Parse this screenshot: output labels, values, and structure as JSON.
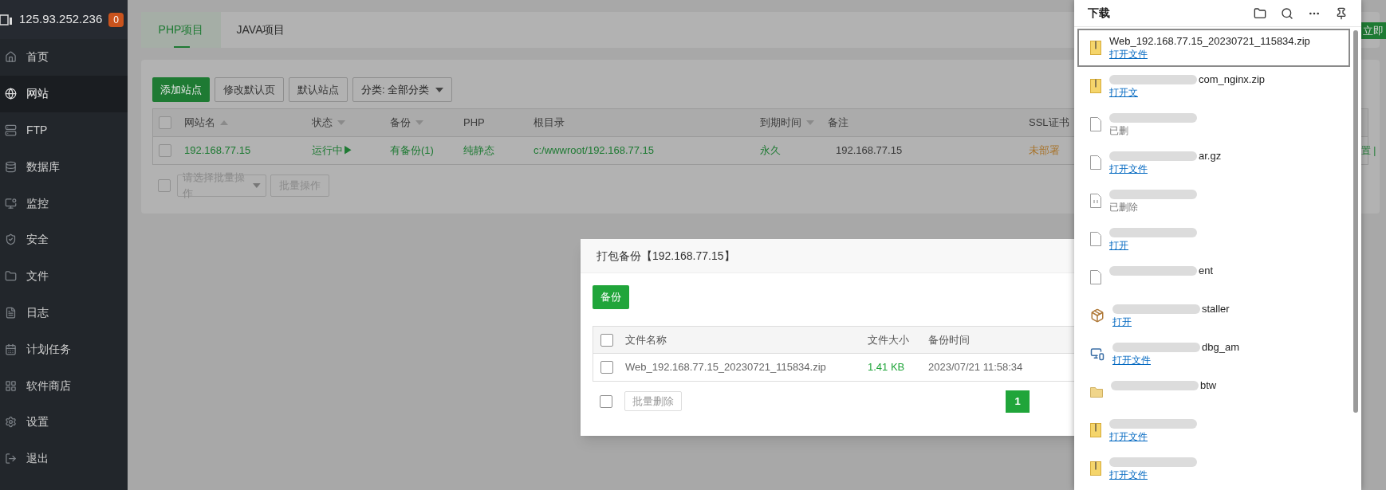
{
  "sidebar": {
    "host": "125.93.252.236",
    "badge": "0",
    "items": [
      {
        "label": "首页",
        "selected": false
      },
      {
        "label": "网站",
        "selected": true
      },
      {
        "label": "FTP",
        "selected": false
      },
      {
        "label": "数据库",
        "selected": false
      },
      {
        "label": "监控",
        "selected": false
      },
      {
        "label": "安全",
        "selected": false
      },
      {
        "label": "文件",
        "selected": false
      },
      {
        "label": "日志",
        "selected": false
      },
      {
        "label": "计划任务",
        "selected": false
      },
      {
        "label": "软件商店",
        "selected": false
      },
      {
        "label": "设置",
        "selected": false
      },
      {
        "label": "退出",
        "selected": false
      }
    ]
  },
  "tabs": [
    {
      "label": "PHP项目",
      "selected": true
    },
    {
      "label": "JAVA项目",
      "selected": false
    }
  ],
  "toolbar": {
    "buttons": [
      {
        "label": "添加站点",
        "kind": "primary"
      },
      {
        "label": "修改默认页",
        "kind": "default"
      },
      {
        "label": "默认站点",
        "kind": "default"
      }
    ],
    "category": "分类: 全部分类"
  },
  "sites_table": {
    "select_all_checked": false,
    "columns": [
      {
        "label": "网站名",
        "kind": "ascending"
      },
      {
        "label": "状态",
        "kind": "descending"
      },
      {
        "label": "备份",
        "kind": "descending"
      },
      {
        "label": "PHP",
        "kind": "plain"
      },
      {
        "label": "根目录",
        "kind": "plain"
      },
      {
        "label": "到期时间",
        "kind": "descending"
      },
      {
        "label": "备注",
        "kind": "plain"
      },
      {
        "label": "SSL证书",
        "kind": "plain"
      }
    ],
    "rows": [
      {
        "checked": false,
        "cells": [
          {
            "text": "192.168.77.15",
            "kind": "link"
          },
          {
            "text": "运行中▶",
            "kind": "link"
          },
          {
            "text": "有备份(1)",
            "kind": "link"
          },
          {
            "text": "纯静态",
            "kind": "link"
          },
          {
            "text": "c:/wwwroot/192.168.77.15",
            "kind": "link"
          },
          {
            "text": "永久",
            "kind": "link"
          },
          {
            "text": "192.168.77.15",
            "kind": "text"
          },
          {
            "text": "未部署",
            "kind": "warning"
          }
        ]
      }
    ]
  },
  "batch": {
    "checked": false,
    "placeholder": "请选择批量操作",
    "button": "批量操作"
  },
  "behind_panel": {
    "button": "立即",
    "row_actions": "置 |"
  },
  "dialog": {
    "title": "打包备份【192.168.77.15】",
    "button": "备份",
    "select_all_checked": false,
    "columns": [
      "文件名称",
      "文件大小",
      "备份时间"
    ],
    "rows": [
      {
        "checked": false,
        "name": "Web_192.168.77.15_20230721_115834.zip",
        "size": "1.41 KB",
        "time": "2023/07/21 11:58:34"
      }
    ],
    "batch_checked": false,
    "batch_button": "批量删除",
    "pages": [
      {
        "label": "1",
        "selected": true
      }
    ]
  },
  "downloads": {
    "title": "下载",
    "items": [
      {
        "kind": "zip",
        "name": "Web_192.168.77.15_20230721_115834.zip",
        "action": "打开文件",
        "deleted": false,
        "redacted": false,
        "selected": true
      },
      {
        "kind": "zip",
        "name": "com_nginx.zip",
        "action": "打开文",
        "deleted": false,
        "redacted": true,
        "selected": false
      },
      {
        "kind": "file",
        "action": "已删",
        "deleted": true,
        "redacted": true,
        "selected": false
      },
      {
        "kind": "file",
        "name": "ar.gz",
        "action": "打开文件",
        "deleted": false,
        "redacted": true,
        "selected": false
      },
      {
        "kind": "script",
        "action": "已删除",
        "deleted": true,
        "redacted": true,
        "selected": false
      },
      {
        "kind": "file",
        "action": "打开",
        "deleted": false,
        "redacted": true,
        "selected": false
      },
      {
        "kind": "file",
        "name": "ent",
        "redacted": true,
        "selected": false
      },
      {
        "kind": "package",
        "name": "staller",
        "action": "打开",
        "deleted": false,
        "redacted": true,
        "selected": false
      },
      {
        "kind": "installer",
        "name": "dbg_am",
        "action": "打开文件",
        "deleted": false,
        "redacted": true,
        "selected": false
      },
      {
        "kind": "folder",
        "name": "btw",
        "redacted": true,
        "selected": false
      },
      {
        "kind": "zip",
        "action": "打开文件",
        "deleted": false,
        "redacted": true,
        "selected": false
      },
      {
        "kind": "zip",
        "action": "打开文件",
        "deleted": false,
        "redacted": true,
        "selected": false
      }
    ]
  }
}
